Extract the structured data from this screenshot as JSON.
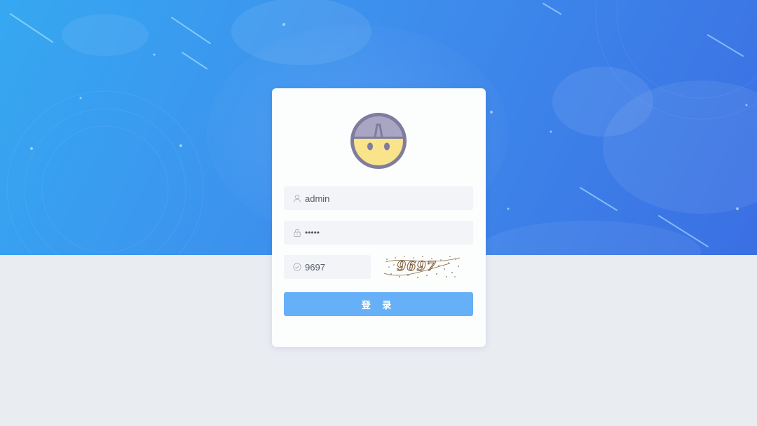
{
  "login": {
    "username_value": "admin",
    "password_value": "•••••",
    "captcha_value": "9697",
    "captcha_image_text": "9697",
    "submit_label": "登 录"
  },
  "colors": {
    "hero_start": "#36a8f1",
    "hero_end": "#3b6fe3",
    "page_background": "#e9ecf1",
    "input_background": "#f3f4f8",
    "button": "#66b0f8",
    "avatar_face": "#f9e38b",
    "avatar_hair": "#a8a6c3",
    "avatar_outline": "#807c9e"
  },
  "icons": {
    "avatar": "avatar-icon",
    "username": "user-icon",
    "password": "lock-icon",
    "captcha": "check-circle-icon"
  }
}
